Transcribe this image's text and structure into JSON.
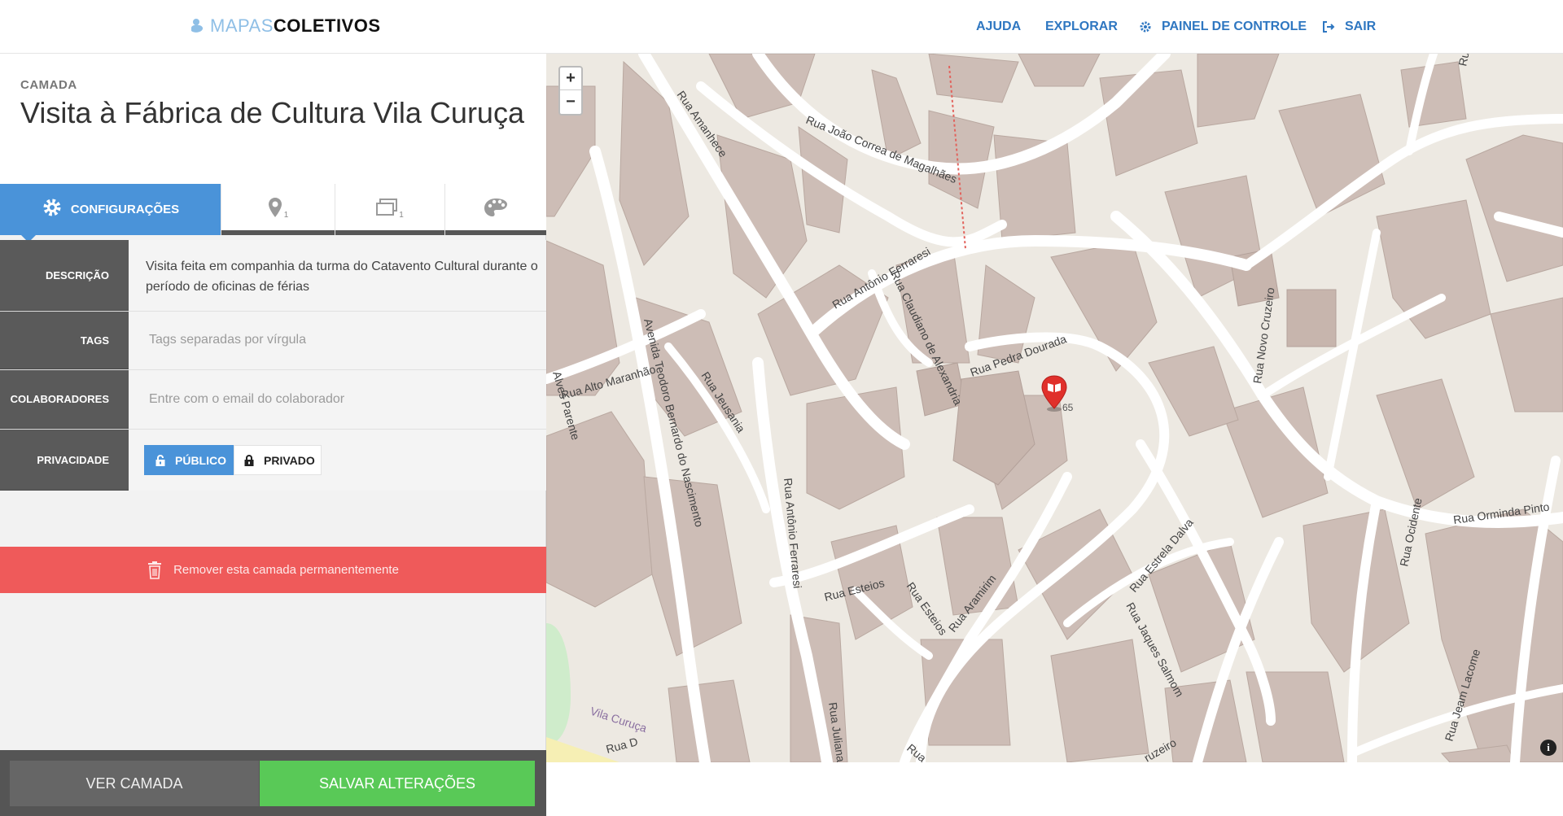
{
  "header": {
    "logo_light": "MAPAS",
    "logo_bold": "COLETIVOS",
    "nav": [
      {
        "label": "AJUDA"
      },
      {
        "label": "EXPLORAR"
      },
      {
        "label": "PAINEL DE CONTROLE",
        "icon": "gear-icon"
      },
      {
        "label": "SAIR",
        "icon": "sign-out-icon"
      }
    ]
  },
  "layer": {
    "kicker": "CAMADA",
    "title": "Visita à Fábrica de Cultura Vila Curuça"
  },
  "tabs": [
    {
      "label": "CONFIGURAÇÕES",
      "icon": "gear-icon",
      "active": true
    },
    {
      "count": "1",
      "icon": "map-marker-icon"
    },
    {
      "count": "1",
      "icon": "stacked-images-icon"
    },
    {
      "icon": "palette-icon"
    }
  ],
  "form": {
    "description_label": "DESCRIÇÃO",
    "description_value": "Visita feita em companhia da turma do Catavento Cultural durante o período de oficinas de férias",
    "tags_label": "TAGS",
    "tags_placeholder": "Tags separadas por vírgula",
    "collab_label": "COLABORADORES",
    "collab_placeholder": "Entre com o email do colaborador",
    "privacy_label": "PRIVACIDADE",
    "privacy_public": "PÚBLICO",
    "privacy_private": "PRIVADO",
    "privacy_selected": "PÚBLICO"
  },
  "remove_label": "Remover esta camada permanentemente",
  "footer": {
    "view_label": "VER CAMADA",
    "save_label": "SALVAR ALTERAÇÕES"
  },
  "map": {
    "zoom_in": "+",
    "zoom_out": "−",
    "marker_count": "65",
    "info": "i",
    "streets": [
      "Rua Amanhece",
      "Rua João Correa de Magalhães",
      "Rua Antônio Ferraresi",
      "Rua Claudiano de Alexandria",
      "Rua Pedra Dourada",
      "Rua Alto Maranhão",
      "Avenida Teodoro Bernardo do Nascimento",
      "Rua Jeusania",
      "Rua Antônio Ferraresi",
      "Rua Esteios",
      "Rua Esteios",
      "Rua Aramirim",
      "Rua Estrela Dalva",
      "Rua Jaques Salmom",
      "Rua Novo Cruzeiro",
      "Rua Orminda Pinto",
      "Rua Ocidente",
      "Rua Jeam Lacome",
      "Rua Juliana",
      "Vila Curuça",
      "Rua",
      "Rua D",
      "ruzeiro",
      "Rua",
      "Alves Parente"
    ]
  },
  "colors": {
    "accent": "#4a93d9",
    "save": "#59c957",
    "danger": "#ef5a5a",
    "map_bg": "#ede9e2",
    "building": "#cdbdb6",
    "marker": "#e0302b"
  }
}
